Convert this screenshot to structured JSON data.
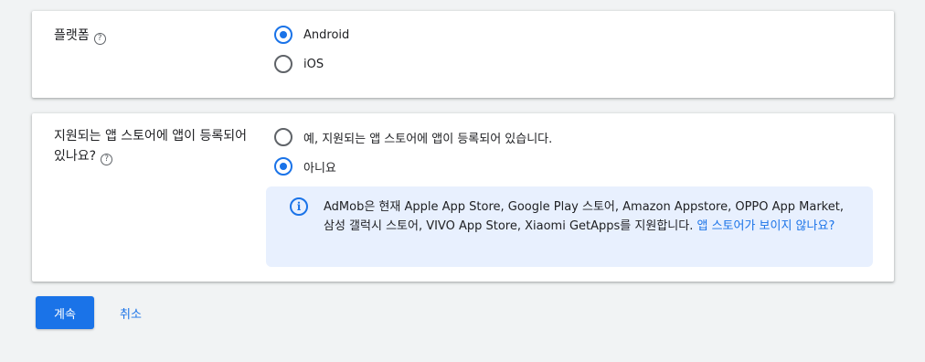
{
  "platform": {
    "label": "플랫폼",
    "help_icon": "help-icon",
    "options": [
      {
        "label": "Android",
        "checked": true
      },
      {
        "label": "iOS",
        "checked": false
      }
    ]
  },
  "store": {
    "label": "지원되는 앱 스토어에 앱이 등록되어 있나요?",
    "help_icon": "help-icon",
    "options": [
      {
        "label": "예, 지원되는 앱 스토어에 앱이 등록되어 있습니다.",
        "checked": false
      },
      {
        "label": "아니요",
        "checked": true
      }
    ],
    "info": {
      "icon": "info-icon",
      "text": "AdMob은 현재 Apple App Store, Google Play 스토어, Amazon Appstore, OPPO App Market, 삼성 갤럭시 스토어, VIVO App Store, Xiaomi GetApps를 지원합니다.",
      "link": "앱 스토어가 보이지 않나요?"
    }
  },
  "actions": {
    "continue_label": "계속",
    "cancel_label": "취소"
  },
  "colors": {
    "accent": "#1a73e8",
    "info_background": "#e8f0fe",
    "page_background": "#f1f3f4"
  }
}
